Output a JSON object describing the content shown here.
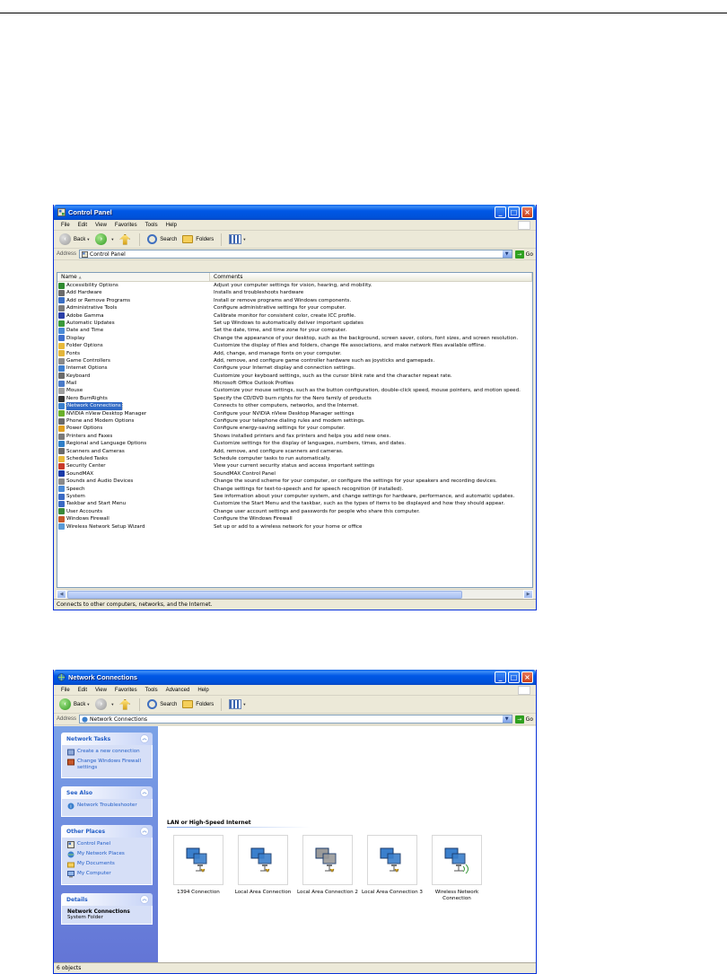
{
  "control_panel": {
    "title": "Control Panel",
    "menu": [
      "File",
      "Edit",
      "View",
      "Favorites",
      "Tools",
      "Help"
    ],
    "toolbar": {
      "back": "Back",
      "search": "Search",
      "folders": "Folders"
    },
    "address": {
      "label": "Address",
      "value": "Control Panel",
      "go": "Go"
    },
    "columns": {
      "name": "Name",
      "comments": "Comments"
    },
    "items": [
      {
        "name": "Accessibility Options",
        "comment": "Adjust your computer settings for vision, hearing, and mobility.",
        "color": "#2f8a2f"
      },
      {
        "name": "Add Hardware",
        "comment": "Installs and troubleshoots hardware",
        "color": "#6b6b6b"
      },
      {
        "name": "Add or Remove Programs",
        "comment": "Install or remove programs and Windows components.",
        "color": "#3b6fc4"
      },
      {
        "name": "Administrative Tools",
        "comment": "Configure administrative settings for your computer.",
        "color": "#7b7b7b"
      },
      {
        "name": "Adobe Gamma",
        "comment": "Calibrate monitor for consistent color, create ICC profile.",
        "color": "#2b3fa8"
      },
      {
        "name": "Automatic Updates",
        "comment": "Set up Windows to automatically deliver important updates",
        "color": "#3a9a3a"
      },
      {
        "name": "Date and Time",
        "comment": "Set the date, time, and time zone for your computer.",
        "color": "#4a8ad6"
      },
      {
        "name": "Display",
        "comment": "Change the appearance of your desktop, such as the background, screen saver, colors, font sizes, and screen resolution.",
        "color": "#3d6ecc"
      },
      {
        "name": "Folder Options",
        "comment": "Customize the display of files and folders, change file associations, and make network files available offline.",
        "color": "#e8b93a"
      },
      {
        "name": "Fonts",
        "comment": "Add, change, and manage fonts on your computer.",
        "color": "#e3b53a"
      },
      {
        "name": "Game Controllers",
        "comment": "Add, remove, and configure game controller hardware such as joysticks and gamepads.",
        "color": "#8a8a8a"
      },
      {
        "name": "Internet Options",
        "comment": "Configure your Internet display and connection settings.",
        "color": "#3f7fd0"
      },
      {
        "name": "Keyboard",
        "comment": "Customize your keyboard settings, such as the cursor blink rate and the character repeat rate.",
        "color": "#6a6a6a"
      },
      {
        "name": "Mail",
        "comment": "Microsoft Office Outlook Profiles",
        "color": "#4a7ac8"
      },
      {
        "name": "Mouse",
        "comment": "Customize your mouse settings, such as the button configuration, double-click speed, mouse pointers, and motion speed.",
        "color": "#a0a0a0"
      },
      {
        "name": "Nero BurnRights",
        "comment": "Specify the CD/DVD burn rights for the Nero family of products",
        "color": "#333333"
      },
      {
        "name": "Network Connections",
        "comment": "Connects to other computers, networks, and the Internet.",
        "color": "#3a7fcc",
        "selected": true
      },
      {
        "name": "NVIDIA nView Desktop Manager",
        "comment": "Configure your NVIDIA nView Desktop Manager settings",
        "color": "#6ab02a"
      },
      {
        "name": "Phone and Modem Options",
        "comment": "Configure your telephone dialing rules and modem settings.",
        "color": "#6a6a6a"
      },
      {
        "name": "Power Options",
        "comment": "Configure energy-saving settings for your computer.",
        "color": "#e0a020"
      },
      {
        "name": "Printers and Faxes",
        "comment": "Shows installed printers and fax printers and helps you add new ones.",
        "color": "#7a7a7a"
      },
      {
        "name": "Regional and Language Options",
        "comment": "Customize settings for the display of languages, numbers, times, and dates.",
        "color": "#2f7fc8"
      },
      {
        "name": "Scanners and Cameras",
        "comment": "Add, remove, and configure scanners and cameras.",
        "color": "#6a6a6a"
      },
      {
        "name": "Scheduled Tasks",
        "comment": "Schedule computer tasks to run automatically.",
        "color": "#e8b93a"
      },
      {
        "name": "Security Center",
        "comment": "View your current security status and access important settings",
        "color": "#c83a2a"
      },
      {
        "name": "SoundMAX",
        "comment": "SoundMAX Control Panel",
        "color": "#1a3aa8"
      },
      {
        "name": "Sounds and Audio Devices",
        "comment": "Change the sound scheme for your computer, or configure the settings for your speakers and recording devices.",
        "color": "#8a8a8a"
      },
      {
        "name": "Speech",
        "comment": "Change settings for text-to-speech and for speech recognition (if installed).",
        "color": "#4a8ad6"
      },
      {
        "name": "System",
        "comment": "See information about your computer system, and change settings for hardware, performance, and automatic updates.",
        "color": "#3a6ac4"
      },
      {
        "name": "Taskbar and Start Menu",
        "comment": "Customize the Start Menu and the taskbar, such as the types of items to be displayed and how they should appear.",
        "color": "#3a6ac4"
      },
      {
        "name": "User Accounts",
        "comment": "Change user account settings and passwords for people who share this computer.",
        "color": "#3a8a3a"
      },
      {
        "name": "Windows Firewall",
        "comment": "Configure the Windows Firewall",
        "color": "#c8582a"
      },
      {
        "name": "Wireless Network Setup Wizard",
        "comment": "Set up or add to a wireless network for your home or office",
        "color": "#5a9ad6"
      }
    ],
    "status": "Connects to other computers, networks, and the Internet."
  },
  "network_connections": {
    "title": "Network Connections",
    "menu": [
      "File",
      "Edit",
      "View",
      "Favorites",
      "Tools",
      "Advanced",
      "Help"
    ],
    "toolbar": {
      "back": "Back",
      "search": "Search",
      "folders": "Folders"
    },
    "address": {
      "label": "Address",
      "value": "Network Connections",
      "go": "Go"
    },
    "tasks": {
      "network_tasks": {
        "title": "Network Tasks",
        "links": [
          "Create a new connection",
          "Change Windows Firewall settings"
        ]
      },
      "see_also": {
        "title": "See Also",
        "links": [
          "Network Troubleshooter"
        ]
      },
      "other_places": {
        "title": "Other Places",
        "links": [
          "Control Panel",
          "My Network Places",
          "My Documents",
          "My Computer"
        ]
      },
      "details": {
        "title": "Details",
        "name": "Network Connections",
        "type": "System Folder"
      }
    },
    "group": "LAN or High-Speed Internet",
    "connections": [
      {
        "label": "1394 Connection",
        "icon": "lan-connection-icon",
        "state": "enabled"
      },
      {
        "label": "Local Area Connection",
        "icon": "lan-connection-icon",
        "state": "enabled"
      },
      {
        "label": "Local Area Connection 2",
        "icon": "lan-connection-icon",
        "state": "disabled"
      },
      {
        "label": "Local Area Connection 3",
        "icon": "lan-connection-icon",
        "state": "enabled"
      },
      {
        "label": "Wireless Network Connection",
        "icon": "wireless-connection-icon",
        "state": "enabled"
      }
    ],
    "status": "6 objects"
  }
}
